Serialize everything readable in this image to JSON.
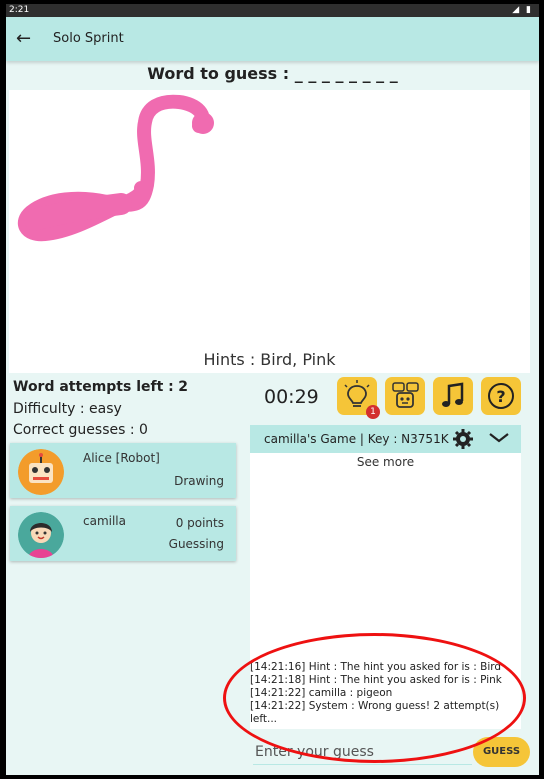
{
  "status": {
    "time": "2:21"
  },
  "appbar": {
    "title": "Solo Sprint"
  },
  "word": {
    "label": "Word to guess : _ _ _ _ _ _ _ _"
  },
  "hints": {
    "text": "Hints : Bird, Pink"
  },
  "stats": {
    "attempts_label": "Word attempts left :",
    "attempts_value": "2",
    "difficulty": "Difficulty :  easy",
    "correct": "Correct guesses :  0"
  },
  "players": [
    {
      "name": "Alice [Robot]",
      "points": "",
      "role": "Drawing"
    },
    {
      "name": "camilla",
      "points": "0 points",
      "role": "Guessing"
    }
  ],
  "timer": "00:29",
  "hint_badge": "1",
  "chat": {
    "game_title": "camilla's Game  | Key :  N3751K",
    "see_more": "See more",
    "messages": [
      "[14:21:16] Hint : The hint you asked for is : Bird",
      "[14:21:18] Hint : The hint you asked for is : Pink",
      "[14:21:22] camilla : pigeon",
      "[14:21:22] System : Wrong guess! 2 attempt(s)",
      "left..."
    ]
  },
  "guess": {
    "placeholder": "Enter your guess",
    "button": "GUESS"
  },
  "colors": {
    "teal": "#b8e8e4",
    "yellow": "#f5c538",
    "pink": "#f06bb0",
    "annotation": "#e11111"
  }
}
